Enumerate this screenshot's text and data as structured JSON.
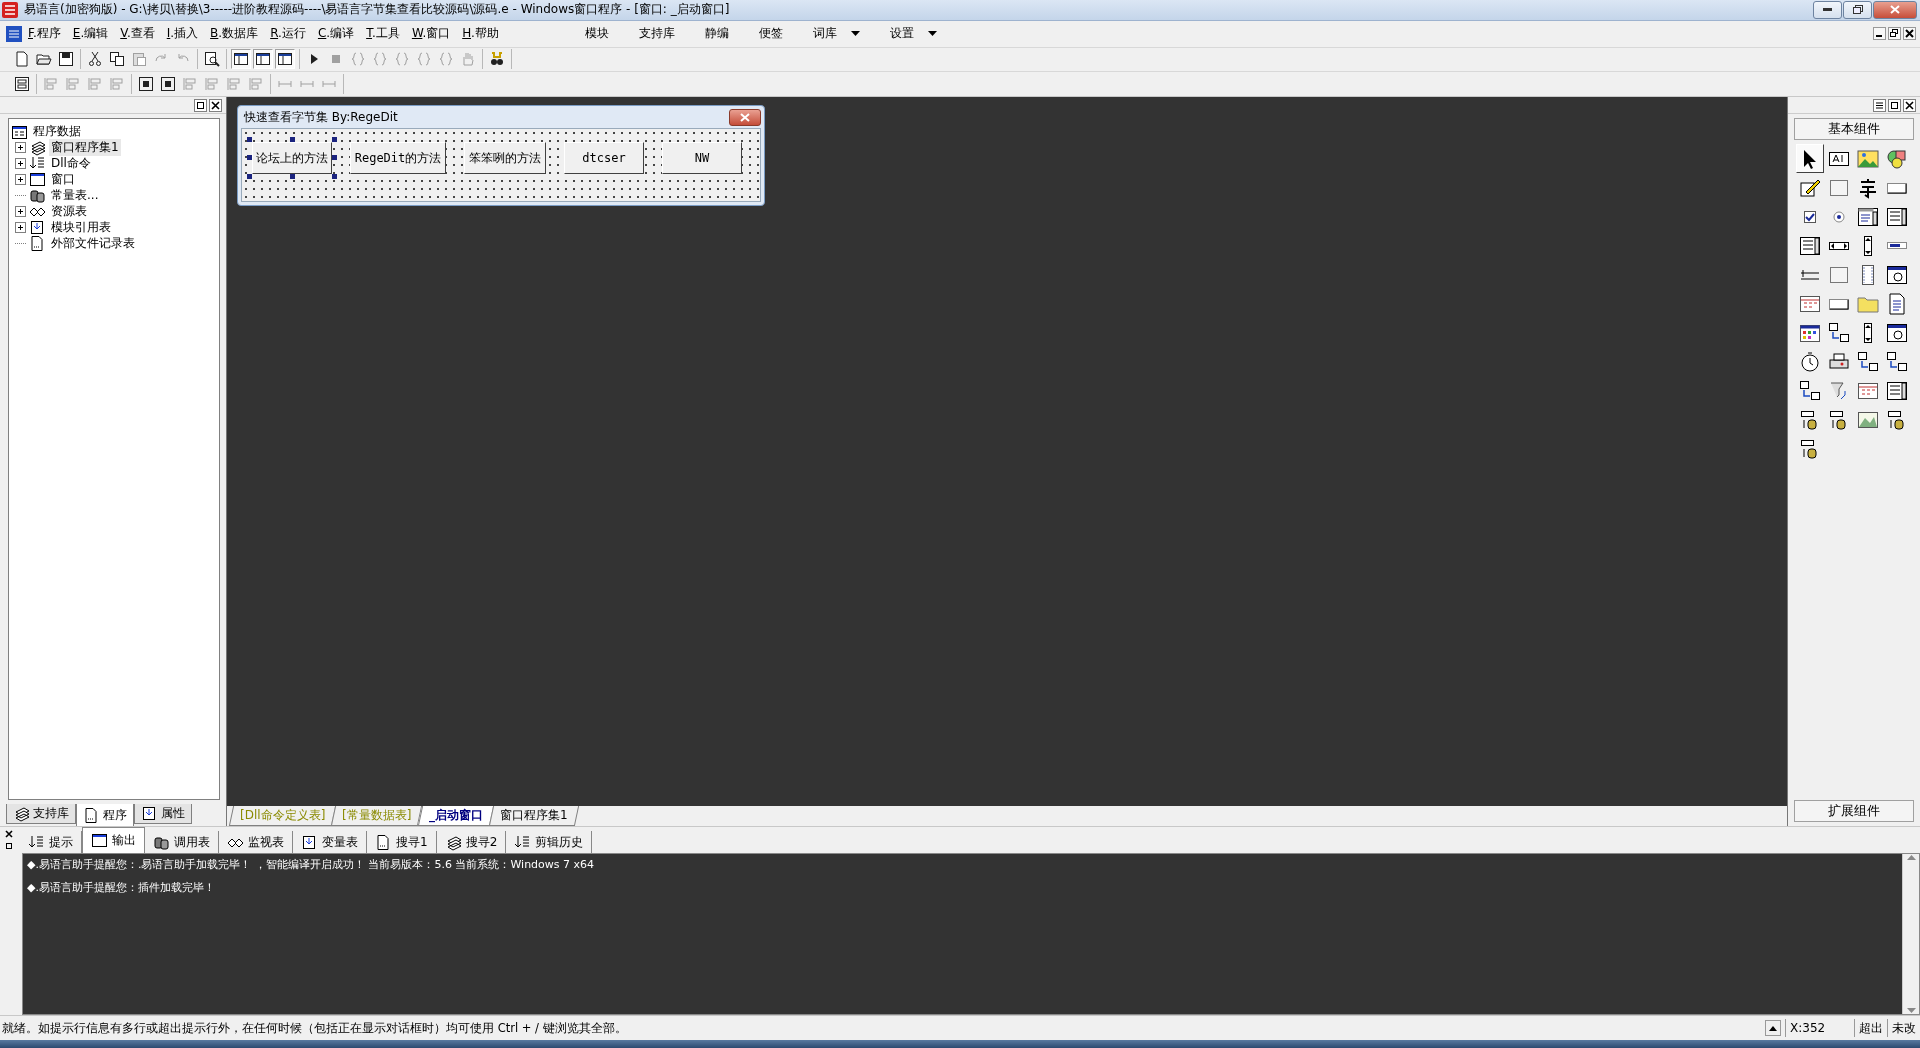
{
  "window": {
    "title": "易语言(加密狗版) - G:\\拷贝\\替换\\3-----进阶教程源码----\\易语言字节集查看比较源码\\源码.e - Windows窗口程序 - [窗口: _启动窗口]"
  },
  "menu": {
    "items": [
      "F.程序",
      "E.编辑",
      "V.查看",
      "I.插入",
      "B.数据库",
      "R.运行",
      "C.编译",
      "T.工具",
      "W.窗口",
      "H.帮助"
    ],
    "right_items": [
      {
        "label": "模块",
        "dropdown": false
      },
      {
        "label": "支持库",
        "dropdown": false
      },
      {
        "label": "静编",
        "dropdown": false
      },
      {
        "label": "便签",
        "dropdown": false
      },
      {
        "label": "词库",
        "dropdown": true
      },
      {
        "label": "设置",
        "dropdown": true
      }
    ]
  },
  "toolbar_1": [
    [
      {
        "kind": "new",
        "disabled": false
      },
      {
        "kind": "open",
        "disabled": false
      },
      {
        "kind": "save",
        "disabled": false
      }
    ],
    [
      {
        "kind": "cut",
        "disabled": false
      },
      {
        "kind": "copy",
        "disabled": false
      },
      {
        "kind": "paste",
        "disabled": true
      },
      {
        "kind": "redo",
        "disabled": true
      },
      {
        "kind": "undo",
        "disabled": true
      }
    ],
    [
      {
        "kind": "find",
        "disabled": false
      }
    ],
    [
      {
        "kind": "panel",
        "disabled": false
      },
      {
        "kind": "panel",
        "disabled": false
      },
      {
        "kind": "panel",
        "disabled": false
      }
    ],
    [
      {
        "kind": "run",
        "disabled": false
      },
      {
        "kind": "stop",
        "disabled": true
      },
      {
        "kind": "step",
        "disabled": true
      },
      {
        "kind": "brace",
        "disabled": true
      },
      {
        "kind": "brace",
        "disabled": true
      },
      {
        "kind": "brace",
        "disabled": true
      },
      {
        "kind": "brace",
        "disabled": true
      },
      {
        "kind": "hand",
        "disabled": true
      }
    ],
    [
      {
        "kind": "binoculars",
        "disabled": false
      }
    ]
  ],
  "toolbar_2": [
    [
      {
        "kind": "form",
        "disabled": false
      }
    ],
    [
      {
        "kind": "align",
        "disabled": true
      },
      {
        "kind": "align",
        "disabled": true
      },
      {
        "kind": "align",
        "disabled": true
      },
      {
        "kind": "align",
        "disabled": true
      }
    ],
    [
      {
        "kind": "center",
        "disabled": false
      },
      {
        "kind": "center",
        "disabled": false
      },
      {
        "kind": "align",
        "disabled": true
      },
      {
        "kind": "align",
        "disabled": true
      },
      {
        "kind": "align",
        "disabled": true
      },
      {
        "kind": "align",
        "disabled": true
      }
    ],
    [
      {
        "kind": "size",
        "disabled": true
      },
      {
        "kind": "size",
        "disabled": true
      },
      {
        "kind": "size",
        "disabled": true
      }
    ]
  ],
  "tree": {
    "root": "程序数据",
    "items": [
      {
        "label": "窗口程序集1",
        "kind": "node",
        "expanded": false,
        "selected": true
      },
      {
        "label": "Dll命令",
        "kind": "node",
        "expanded": false,
        "selected": false
      },
      {
        "label": "窗口",
        "kind": "node",
        "expanded": false,
        "selected": false
      },
      {
        "label": "常量表...",
        "kind": "leaf",
        "selected": false
      },
      {
        "label": "资源表",
        "kind": "node",
        "expanded": false,
        "selected": false
      },
      {
        "label": "模块引用表",
        "kind": "node",
        "expanded": false,
        "selected": false
      },
      {
        "label": "外部文件记录表",
        "kind": "leaf",
        "selected": false
      }
    ]
  },
  "left_tabs": [
    {
      "label": "支持库",
      "selected": false
    },
    {
      "label": "程序",
      "selected": true
    },
    {
      "label": "属性",
      "selected": false
    }
  ],
  "design_window": {
    "title": "快速查看字节集 By:RegeDit",
    "buttons": [
      {
        "label": "论坛上的方法",
        "selected": true
      },
      {
        "label": "RegeDit的方法",
        "selected": false
      },
      {
        "label": "笨笨咧的方法",
        "selected": false
      },
      {
        "label": "dtcser",
        "selected": false
      },
      {
        "label": "NW",
        "selected": false
      }
    ]
  },
  "editor_tabs": [
    {
      "label": "[Dll命令定义表]",
      "selected": false
    },
    {
      "label": "[常量数据表]",
      "selected": false
    },
    {
      "label": "_启动窗口",
      "selected": true
    },
    {
      "label": "窗口程序集1",
      "selected": false
    }
  ],
  "toolbox": {
    "title": "基本组件",
    "footer": "扩展组件",
    "tools": [
      {
        "kind": "pointer",
        "selected": true
      },
      {
        "kind": "label",
        "selected": false
      },
      {
        "kind": "picture",
        "selected": false
      },
      {
        "kind": "shapes",
        "selected": false
      },
      {
        "kind": "edit",
        "selected": false
      },
      {
        "kind": "frame",
        "selected": false
      },
      {
        "kind": "text",
        "selected": false
      },
      {
        "kind": "button",
        "selected": false
      },
      {
        "kind": "check",
        "selected": false
      },
      {
        "kind": "radio",
        "selected": false
      },
      {
        "kind": "combo",
        "selected": false
      },
      {
        "kind": "list",
        "selected": false
      },
      {
        "kind": "list",
        "selected": false
      },
      {
        "kind": "hscroll",
        "selected": false
      },
      {
        "kind": "vscroll",
        "selected": false
      },
      {
        "kind": "progress",
        "selected": false
      },
      {
        "kind": "ruler",
        "selected": false
      },
      {
        "kind": "frame",
        "selected": false
      },
      {
        "kind": "film",
        "selected": false
      },
      {
        "kind": "window",
        "selected": false
      },
      {
        "kind": "grid",
        "selected": false
      },
      {
        "kind": "button",
        "selected": false
      },
      {
        "kind": "folder",
        "selected": false
      },
      {
        "kind": "document",
        "selected": false
      },
      {
        "kind": "palette",
        "selected": false
      },
      {
        "kind": "network",
        "selected": false
      },
      {
        "kind": "vscroll",
        "selected": false
      },
      {
        "kind": "window",
        "selected": false
      },
      {
        "kind": "clock",
        "selected": false
      },
      {
        "kind": "printer",
        "selected": false
      },
      {
        "kind": "network",
        "selected": false
      },
      {
        "kind": "network",
        "selected": false
      },
      {
        "kind": "network",
        "selected": false
      },
      {
        "kind": "funnel",
        "selected": false
      },
      {
        "kind": "grid",
        "selected": false
      },
      {
        "kind": "list",
        "selected": false
      },
      {
        "kind": "database",
        "selected": false
      },
      {
        "kind": "database",
        "selected": false
      },
      {
        "kind": "chart",
        "selected": false
      },
      {
        "kind": "database",
        "selected": false
      },
      {
        "kind": "database",
        "selected": false
      }
    ]
  },
  "output_tabs": [
    {
      "label": "提示",
      "selected": false
    },
    {
      "label": "输出",
      "selected": true
    },
    {
      "label": "调用表",
      "selected": false
    },
    {
      "label": "监视表",
      "selected": false
    },
    {
      "label": "变量表",
      "selected": false
    },
    {
      "label": "搜寻1",
      "selected": false
    },
    {
      "label": "搜寻2",
      "selected": false
    },
    {
      "label": "剪辑历史",
      "selected": false
    }
  ],
  "output_lines": [
    "◆.易语言助手提醒您：.易语言助手加载完毕！  ，智能编译开启成功！  当前易版本：5.6  当前系统：Windows 7 x64",
    "◆.易语言助手提醒您：插件加载完毕！"
  ],
  "status_bar": {
    "message": "就绪。如提示行信息有多行或超出提示行外，在任何时候（包括正在显示对话框时）均可使用 Ctrl + / 键浏览其全部。",
    "position": "X:352",
    "mode": "超出",
    "modified": "未改"
  }
}
